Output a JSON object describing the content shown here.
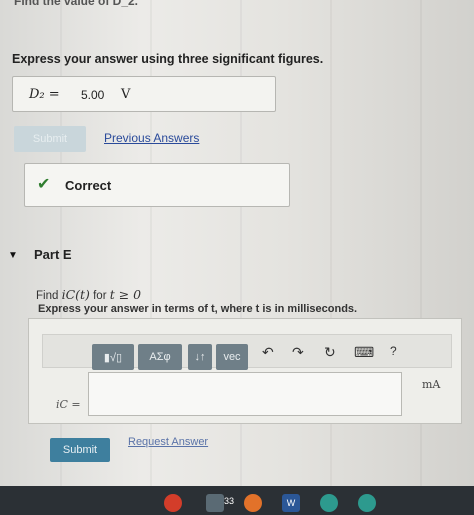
{
  "cutoff_text": "Find the value of D_2.",
  "instruction": "Express your answer using three significant figures.",
  "answer": {
    "variable": "D₂ =",
    "value": "5.00",
    "unit": "V"
  },
  "submit_disabled_label": "Submit",
  "previous_answers_label": "Previous Answers",
  "correct_label": "Correct",
  "part": {
    "title": "Part E"
  },
  "question": {
    "prefix": "Find ",
    "expr": "iC(t)",
    "for_text": " for ",
    "cond": "t ≥ 0"
  },
  "question_instruction": "Express your answer in terms of t, where t is in milliseconds.",
  "toolbar": {
    "template_label": "▮√▯",
    "greek_label": "ΑΣφ",
    "arrows_label": "↓↑",
    "vec_label": "vec",
    "undo_icon": "undo-icon",
    "redo_icon": "redo-icon",
    "reset_icon": "reset-icon",
    "keyboard_icon": "keyboard-icon",
    "help_label": "?"
  },
  "unit_label": "mA",
  "input_label": "iC =",
  "submit_label": "Submit",
  "request_answer_label": "Request Answer",
  "taskbar": {
    "badge": "33"
  }
}
